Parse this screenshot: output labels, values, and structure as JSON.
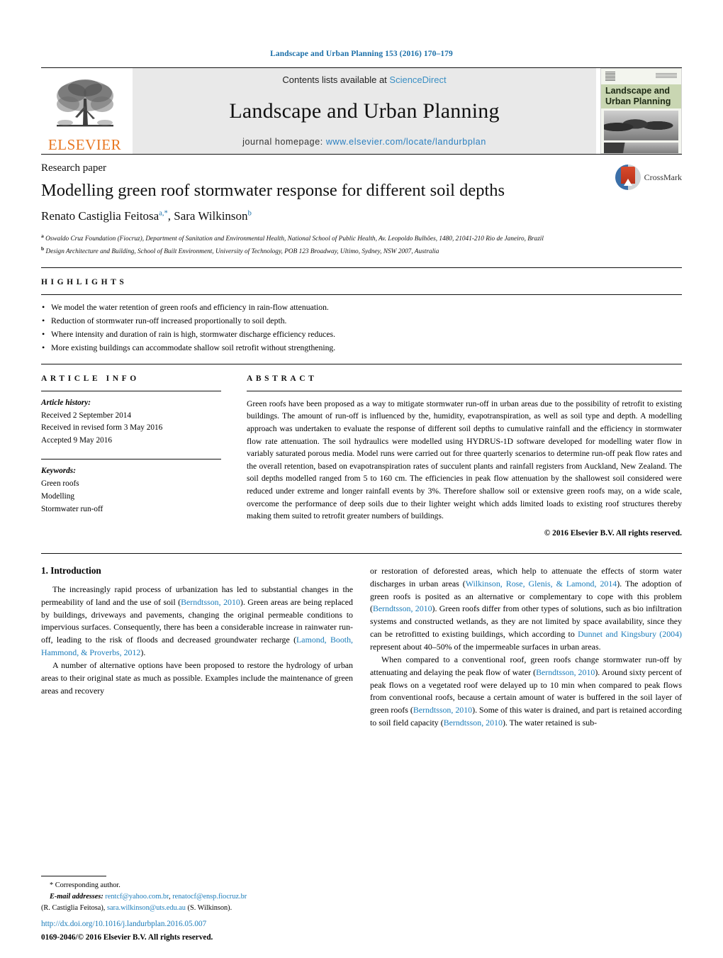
{
  "running_head": "Landscape and Urban Planning 153 (2016) 170–179",
  "masthead": {
    "publisher_logo_label": "ELSEVIER",
    "contents_prefix": "Contents lists available at ",
    "contents_link": "ScienceDirect",
    "journal_name": "Landscape and Urban Planning",
    "homepage_prefix": "journal homepage: ",
    "homepage_url": "www.elsevier.com/locate/landurbplan",
    "cover_title_line1": "Landscape and",
    "cover_title_line2": "Urban Planning"
  },
  "article": {
    "kicker": "Research paper",
    "title": "Modelling green roof stormwater response for different soil depths",
    "author_1": "Renato Castiglia Feitosa",
    "author_1_sup": "a,",
    "author_1_star": "*",
    "author_2": "Sara Wilkinson",
    "author_2_sup": "b",
    "affiliation_a_marker": "a",
    "affiliation_a": "Oswaldo Cruz Foundation (Fiocruz), Department of Sanitation and Environmental Health, National School of Public Health, Av. Leopoldo Bulhões, 1480, 21041-210 Rio de Janeiro, Brazil",
    "affiliation_b_marker": "b",
    "affiliation_b": "Design Architecture and Building, School of Built Environment, University of Technology, POB 123 Broadway, Ultimo, Sydney, NSW 2007, Australia",
    "crossmark_label": "CrossMark"
  },
  "highlights": {
    "heading": "HIGHLIGHTS",
    "items": [
      "We model the water retention of green roofs and efficiency in rain-flow attenuation.",
      "Reduction of stormwater run-off increased proportionally to soil depth.",
      "Where intensity and duration of rain is high, stormwater discharge efficiency reduces.",
      "More existing buildings can accommodate shallow soil retrofit without strengthening."
    ]
  },
  "article_info": {
    "heading": "ARTICLE INFO",
    "history_label": "Article history:",
    "history": [
      "Received 2 September 2014",
      "Received in revised form 3 May 2016",
      "Accepted 9 May 2016"
    ],
    "keywords_label": "Keywords:",
    "keywords": [
      "Green roofs",
      "Modelling",
      "Stormwater run-off"
    ]
  },
  "abstract": {
    "heading": "ABSTRACT",
    "text": "Green roofs have been proposed as a way to mitigate stormwater run-off in urban areas due to the possibility of retrofit to existing buildings. The amount of run-off is influenced by the, humidity, evapotranspiration, as well as soil type and depth. A modelling approach was undertaken to evaluate the response of different soil depths to cumulative rainfall and the efficiency in stormwater flow rate attenuation. The soil hydraulics were modelled using HYDRUS-1D software developed for modelling water flow in variably saturated porous media. Model runs were carried out for three quarterly scenarios to determine run-off peak flow rates and the overall retention, based on evapotranspiration rates of succulent plants and rainfall registers from Auckland, New Zealand. The soil depths modelled ranged from 5 to 160 cm. The efficiencies in peak flow attenuation by the shallowest soil considered were reduced under extreme and longer rainfall events by 3%. Therefore shallow soil or extensive green roofs may, on a wide scale, overcome the performance of deep soils due to their lighter weight which adds limited loads to existing roof structures thereby making them suited to retrofit greater numbers of buildings.",
    "copyright": "© 2016 Elsevier B.V. All rights reserved."
  },
  "body": {
    "section_number_title": "1.  Introduction",
    "left_para_1_a": "The increasingly rapid process of urbanization has led to substantial changes in the permeability of land and the use of soil (",
    "left_para_1_cite_1": "Berndtsson, 2010",
    "left_para_1_b": "). Green areas are being replaced by buildings, driveways and pavements, changing the original permeable conditions to impervious surfaces. Consequently, there has been a considerable increase in rainwater run-off, leading to the risk of floods and decreased groundwater recharge (",
    "left_para_1_cite_2": "Lamond, Booth, Hammond, & Proverbs, 2012",
    "left_para_1_c": ").",
    "left_para_2": "A number of alternative options have been proposed to restore the hydrology of urban areas to their original state as much as possible. Examples include the maintenance of green areas and recovery",
    "right_para_1_a": "or restoration of deforested areas, which help to attenuate the effects of storm water discharges in urban areas (",
    "right_para_1_cite_1": "Wilkinson, Rose, Glenis, & Lamond, 2014",
    "right_para_1_b": "). The adoption of green roofs is posited as an alternative or complementary to cope with this problem (",
    "right_para_1_cite_2": "Berndtsson, 2010",
    "right_para_1_c": "). Green roofs differ from other types of solutions, such as bio infiltration systems and constructed wetlands, as they are not limited by space availability, since they can be retrofitted to existing buildings, which according to ",
    "right_para_1_cite_3": "Dunnet and Kingsbury (2004)",
    "right_para_1_d": " represent about 40–50% of the impermeable surfaces in urban areas.",
    "right_para_2_a": "When compared to a conventional roof, green roofs change stormwater run-off by attenuating and delaying the peak flow of water (",
    "right_para_2_cite_1": "Berndtsson, 2010",
    "right_para_2_b": "). Around sixty percent of peak flows on a vegetated roof were delayed up to 10 min when compared to peak flows from conventional roofs, because a certain amount of water is buffered in the soil layer of green roofs (",
    "right_para_2_cite_2": "Berndtsson, 2010",
    "right_para_2_c": "). Some of this water is drained, and part is retained according to soil field capacity (",
    "right_para_2_cite_3": "Berndtsson, 2010",
    "right_para_2_d": "). The water retained is sub-"
  },
  "footnote": {
    "corresponding_star": "*",
    "corresponding_label": "Corresponding author.",
    "email_label": "E-mail addresses:",
    "email_1": "rentcf@yahoo.com.br",
    "email_sep_1": ", ",
    "email_2": "renatocf@ensp.fiocruz.br",
    "email_owner_1": "(R. Castiglia Feitosa), ",
    "email_3": "sara.wilkinson@uts.edu.au",
    "email_owner_2": " (S. Wilkinson).",
    "doi": "http://dx.doi.org/10.1016/j.landurbplan.2016.05.007",
    "issn": "0169-2046/© 2016 Elsevier B.V. All rights reserved."
  },
  "colors": {
    "link_blue": "#1a7bb9",
    "header_blue": "#1a6ea8",
    "elsevier_orange": "#E87722",
    "masthead_grey": "#e9e9e9",
    "cover_green": "#c9d6b2"
  }
}
